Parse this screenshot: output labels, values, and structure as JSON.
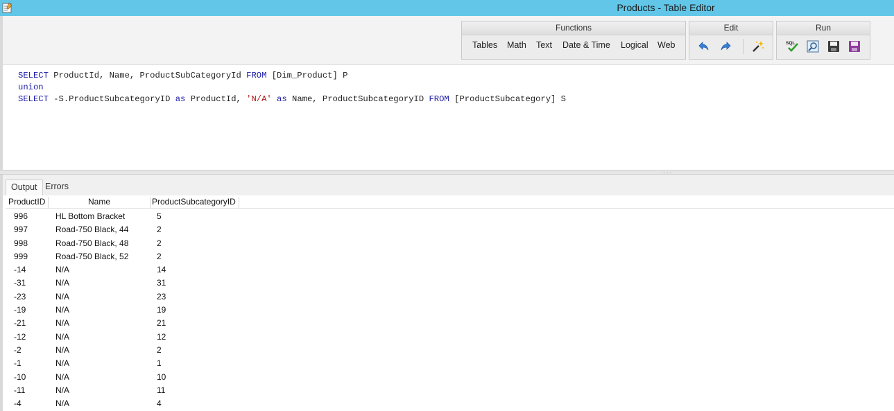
{
  "window": {
    "title": "Products - Table Editor"
  },
  "ribbon": {
    "functions": {
      "label": "Functions",
      "items": [
        "Tables",
        "Math",
        "Text",
        "Date & Time",
        "Logical",
        "Web"
      ]
    },
    "edit": {
      "label": "Edit",
      "icons": [
        "undo-icon",
        "redo-icon",
        "magic-wand-icon"
      ]
    },
    "run": {
      "label": "Run",
      "icons": [
        "sql-check-icon",
        "preview-icon",
        "save-icon",
        "save-as-icon"
      ],
      "sql_text": "SQL"
    }
  },
  "editor": {
    "line1": {
      "kw1": "SELECT",
      "t1": " ProductId, Name, ProductSubCategoryId ",
      "kw2": "FROM",
      "t2": " [Dim_Product] P"
    },
    "line2": {
      "kw1": "union"
    },
    "line3": {
      "kw1": "SELECT",
      "t1": " -S.ProductSubcategoryID ",
      "kw2": "as",
      "t2": " ProductId, ",
      "str": "'N/A'",
      "t3": " ",
      "kw3": "as",
      "t4": " Name, ProductSubcategoryID ",
      "kw4": "FROM",
      "t5": " [ProductSubcategory] S"
    }
  },
  "results": {
    "tabs": [
      "Output",
      "Errors"
    ],
    "columns": [
      "ProductID",
      "Name",
      "ProductSubcategoryID"
    ],
    "rows": [
      [
        "996",
        "HL Bottom Bracket",
        "5"
      ],
      [
        "997",
        "Road-750 Black, 44",
        "2"
      ],
      [
        "998",
        "Road-750 Black, 48",
        "2"
      ],
      [
        "999",
        "Road-750 Black, 52",
        "2"
      ],
      [
        "-14",
        "N/A",
        "14"
      ],
      [
        "-31",
        "N/A",
        "31"
      ],
      [
        "-23",
        "N/A",
        "23"
      ],
      [
        "-19",
        "N/A",
        "19"
      ],
      [
        "-21",
        "N/A",
        "21"
      ],
      [
        "-12",
        "N/A",
        "12"
      ],
      [
        "-2",
        "N/A",
        "2"
      ],
      [
        "-1",
        "N/A",
        "1"
      ],
      [
        "-10",
        "N/A",
        "10"
      ],
      [
        "-11",
        "N/A",
        "11"
      ],
      [
        "-4",
        "N/A",
        "4"
      ]
    ]
  },
  "colors": {
    "titlebar": "#61c6e8",
    "keyword": "#1a1aa6",
    "string": "#b31515"
  }
}
